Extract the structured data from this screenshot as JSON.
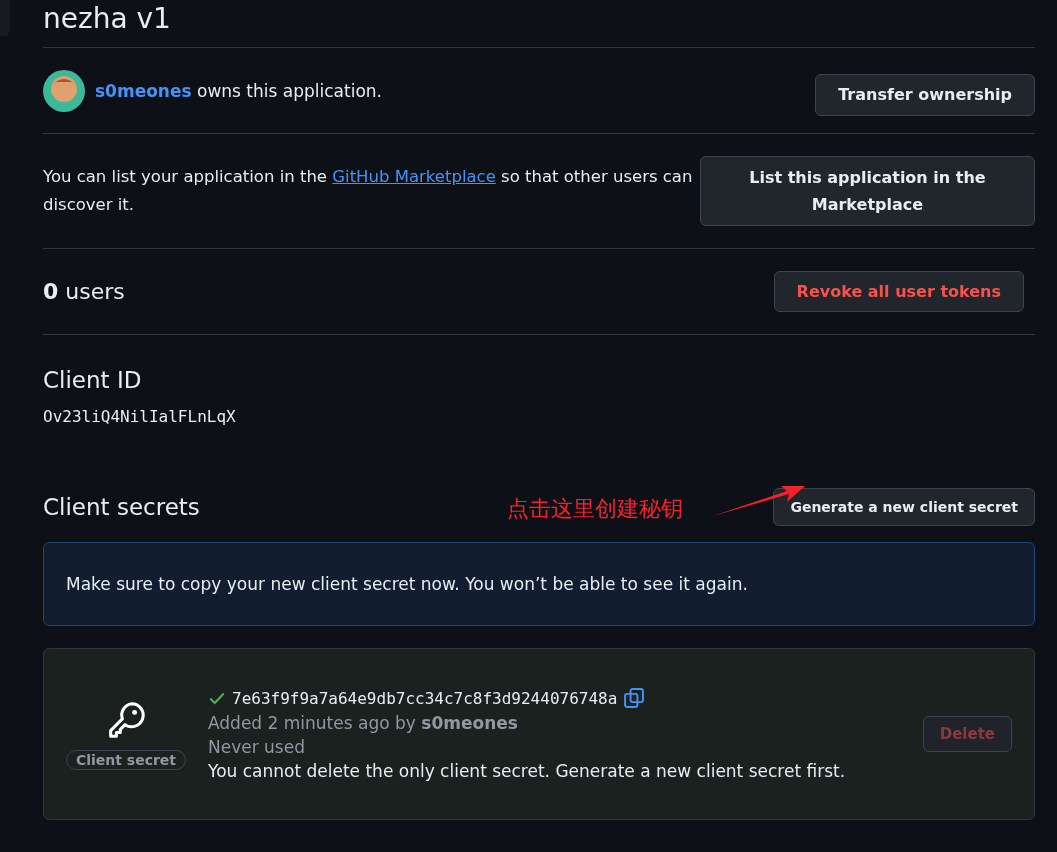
{
  "app": {
    "title": "nezha v1"
  },
  "owner": {
    "username": "s0meones",
    "text": "owns this application.",
    "button": "Transfer ownership"
  },
  "marketplace": {
    "text_before": "You can list your application in the",
    "link": "GitHub Marketplace",
    "text_after": "so that other users can discover it.",
    "button": "List this application in the Marketplace"
  },
  "users": {
    "count_text": "**0** users",
    "button": "Revoke all user tokens"
  },
  "client_id": {
    "heading": "Client ID",
    "value": "Ov23liQ4NilIalFLnLqX"
  },
  "client_secrets": {
    "heading": "Client secrets",
    "button": "Generate a new client secret",
    "annotation": "点击这里创建秘钥",
    "flash": "Make sure to copy your new client secret now. You won’t be able to see it again.",
    "secrets": [
      {
        "badge": "Client secret",
        "value": "7e63f9f9a7a64e9db7cc34c7c8f3d9244076748a",
        "added": "Added 2 minutes ago by",
        "added_by": "s0meones",
        "usage": "Never used",
        "note": "You cannot delete the only client secret. Generate a new client secret first.",
        "delete_button": "Delete",
        "delete_disabled": true
      }
    ]
  }
}
